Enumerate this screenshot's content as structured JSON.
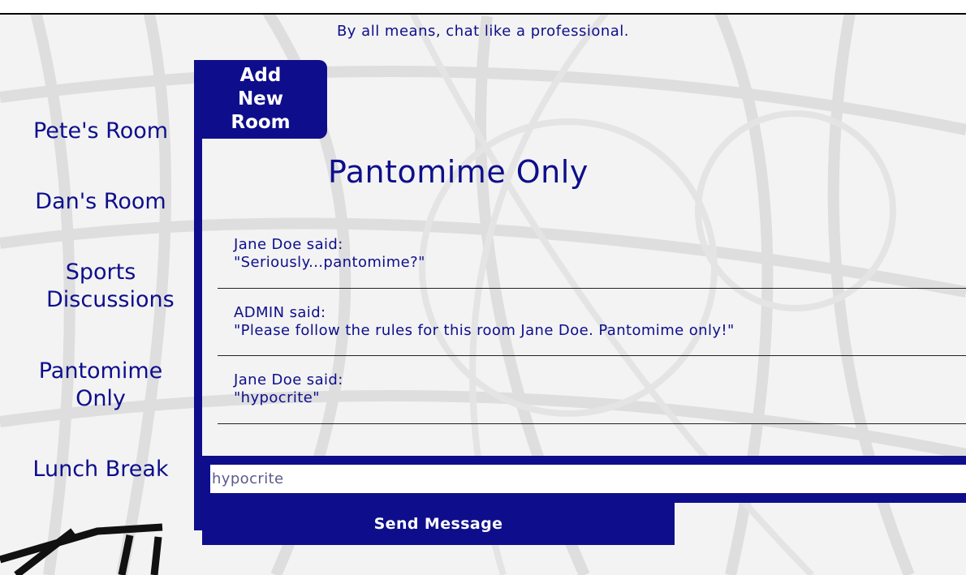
{
  "page": {
    "tagline": "By all means, chat like a professional."
  },
  "sidebar": {
    "rooms": [
      {
        "label": "Pete's Room"
      },
      {
        "label": "Dan's Room"
      },
      {
        "label": "Sports Discussions"
      },
      {
        "label": "Pantomime Only"
      },
      {
        "label": "Lunch Break"
      }
    ]
  },
  "chat": {
    "add_room_label": "Add New Room",
    "room_title": "Pantomime Only",
    "messages": [
      {
        "author_line": "Jane Doe said:",
        "text": "\"Seriously...pantomime?\""
      },
      {
        "author_line": "ADMIN said:",
        "text": "\"Please follow the rules for this room Jane Doe. Pantomime only!\""
      },
      {
        "author_line": "Jane Doe said:",
        "text": "\"hypocrite\""
      }
    ],
    "input_value": "hypocrite",
    "send_label": "Send Message"
  },
  "colors": {
    "accent": "#0e0e8c",
    "background": "#f3f3f3"
  }
}
